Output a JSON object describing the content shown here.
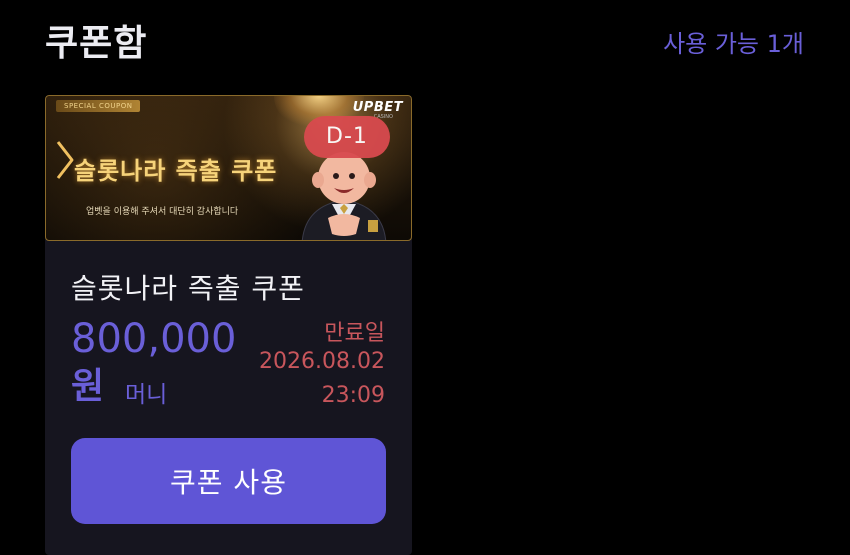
{
  "header": {
    "title": "쿠폰함",
    "available_count": "사용 가능 1개"
  },
  "coupon": {
    "banner": {
      "special_label": "SPECIAL COUPON",
      "logo": "UPBET",
      "logo_sub": "CASINO",
      "title": "슬롯나라 즉출 쿠폰",
      "subtitle": "업벳을 이용해 주셔서 대단히 감사합니다",
      "dday": "D-1"
    },
    "name": "슬롯나라 즉출 쿠폰",
    "amount": "800,000",
    "amount_unit": "원",
    "money_type": "머니",
    "expiry_label": "만료일",
    "expiry_date": "2026.08.02",
    "expiry_time": "23:09",
    "use_button_label": "쿠폰 사용"
  },
  "colors": {
    "accent": "#5f55d6",
    "accent_text": "#6a5fd8",
    "expiry": "#c8565c",
    "dday_badge": "#d84a4e",
    "card_bg": "#16151f",
    "page_bg": "#000000"
  }
}
